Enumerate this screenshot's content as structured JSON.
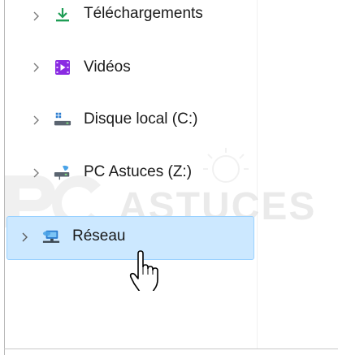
{
  "tree": {
    "items": [
      {
        "label": "Téléchargements",
        "icon": "download-arrow-icon",
        "selected": false
      },
      {
        "label": "Vidéos",
        "icon": "videos-folder-icon",
        "selected": false
      },
      {
        "label": "Disque local (C:)",
        "icon": "local-disk-icon",
        "selected": false
      },
      {
        "label": "PC Astuces (Z:)",
        "icon": "network-drive-icon",
        "selected": false
      },
      {
        "label": "Réseau",
        "icon": "network-icon",
        "selected": true
      }
    ],
    "expander_icon": "chevron-right-icon"
  },
  "cursor": {
    "icon": "hand-pointer-cursor-icon"
  },
  "watermark": {
    "text": "ASTUCES"
  },
  "colors": {
    "selection_bg": "#cce8ff",
    "selection_border": "#99d1ff",
    "download_green": "#1f9d55",
    "video_purple": "#8a2be2",
    "network_blue": "#2b7ccf"
  }
}
